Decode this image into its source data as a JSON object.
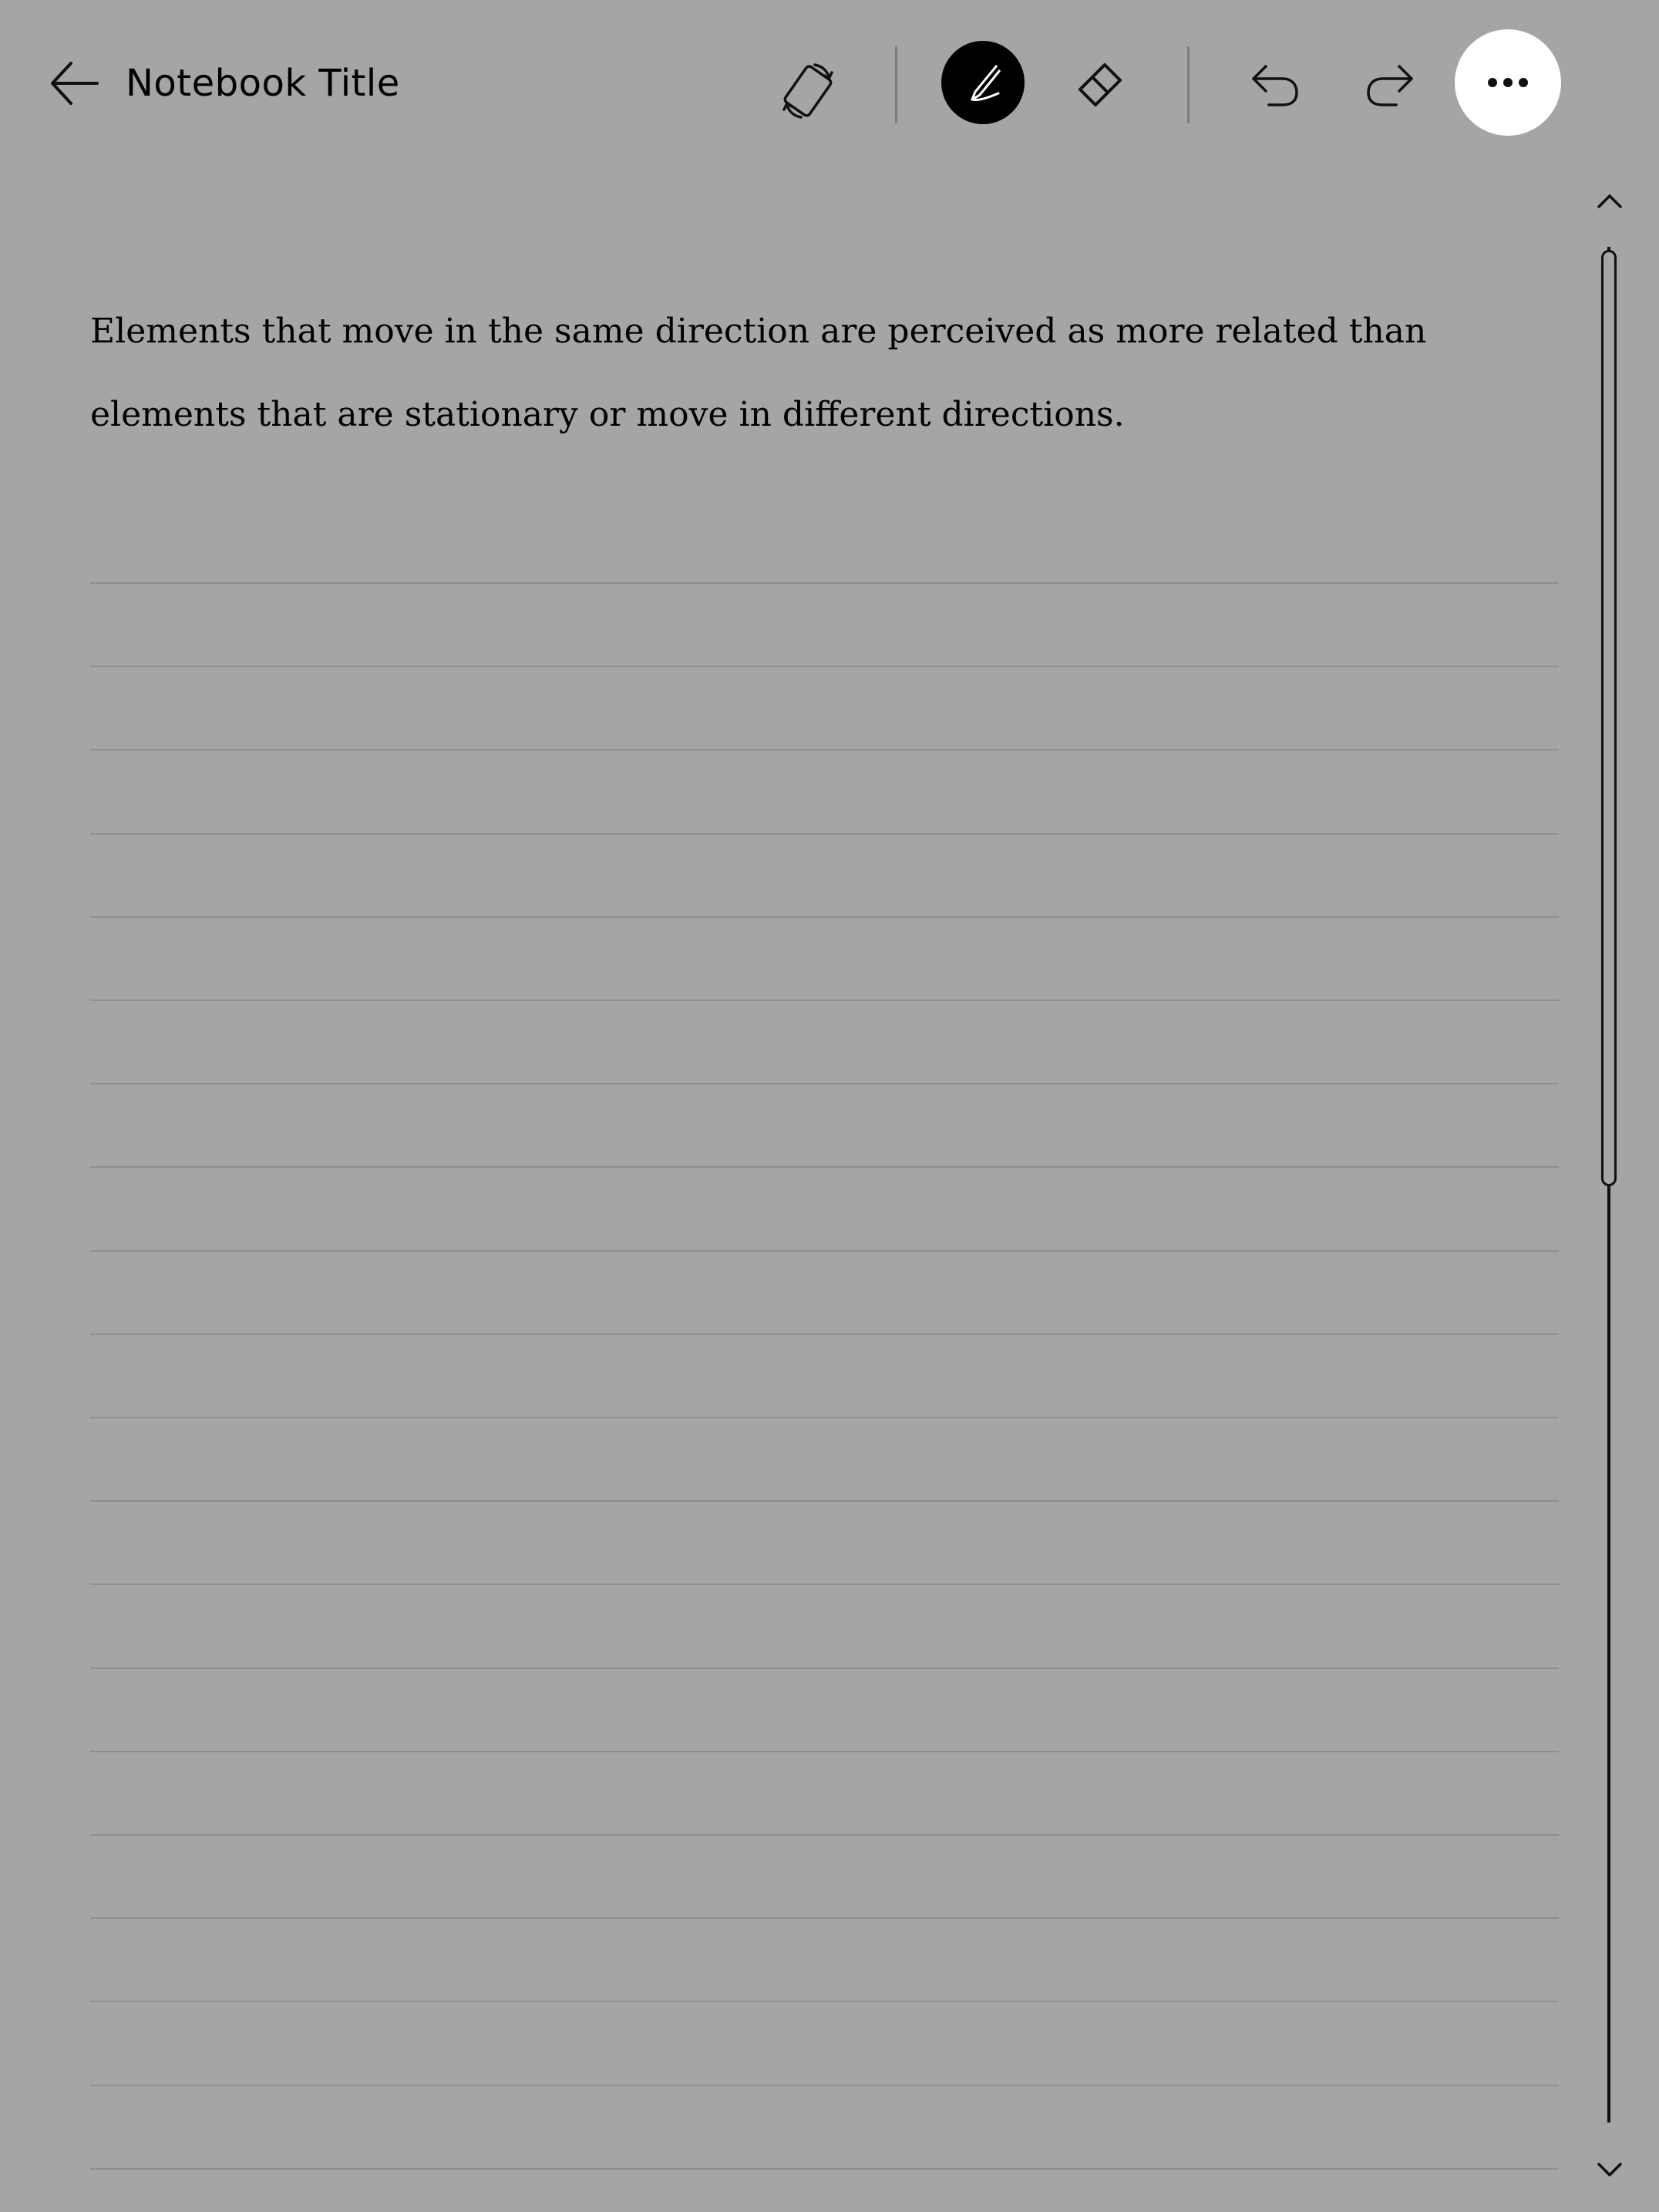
{
  "header": {
    "title": "Notebook Title"
  },
  "toolbar": {
    "icons": [
      "back-arrow-icon",
      "rotate-icon",
      "pen-icon",
      "eraser-icon",
      "undo-icon",
      "redo-icon",
      "more-icon"
    ],
    "active_tool": "pen"
  },
  "page": {
    "text": "Elements that move in the same direction are perceived as more related than elements that are stationary or move in different directions.",
    "ruled_line_count": 20
  },
  "colors": {
    "background": "#a5a5a5",
    "active_tool_bg": "#000000",
    "more_button_bg": "#ffffff",
    "ruled_line": "#8e8e8e"
  },
  "scrollbar": {
    "position_fraction": 0.0,
    "visible_fraction": 0.5
  }
}
